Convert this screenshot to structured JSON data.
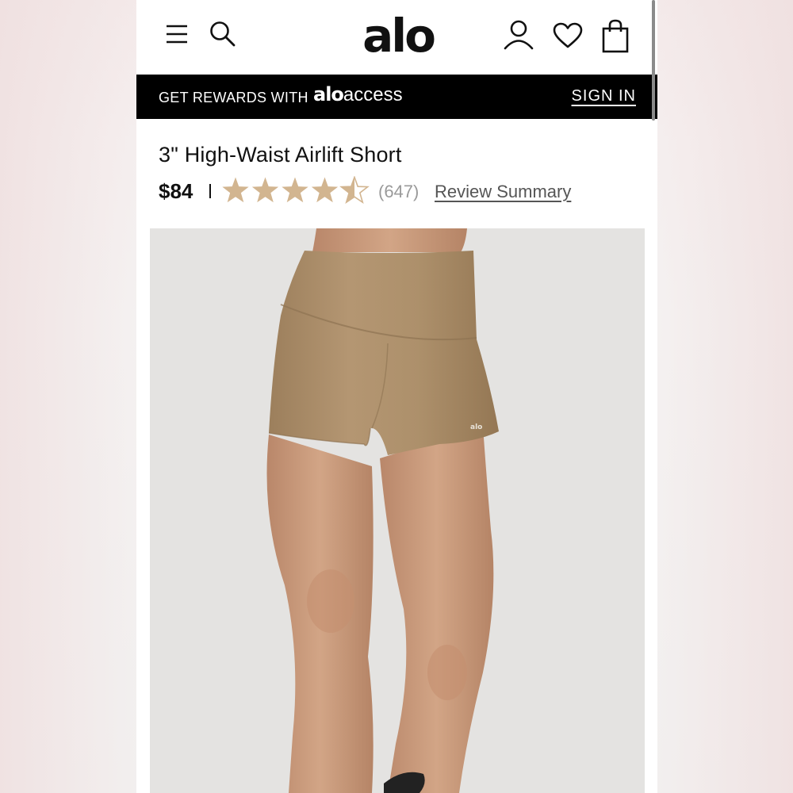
{
  "header": {
    "logo": "alo",
    "icons": [
      "menu-icon",
      "search-icon",
      "account-icon",
      "heart-icon",
      "shopping-bag-icon"
    ]
  },
  "rewards_bar": {
    "text": "GET REWARDS WITH",
    "brand": "alo",
    "brand_suffix": "access",
    "sign_in": "SIGN IN"
  },
  "product": {
    "title": "3\" High-Waist Airlift Short",
    "price": "$84",
    "rating": 4.5,
    "rating_max": 5,
    "review_count": "(647)",
    "review_link": "Review Summary",
    "color_swatch": "#b4976f",
    "image_logo": "alo"
  },
  "colors": {
    "star": "#d2b590",
    "short": "#a98c67",
    "skin": "#c99a78",
    "image_bg": "#e4e3e1"
  }
}
